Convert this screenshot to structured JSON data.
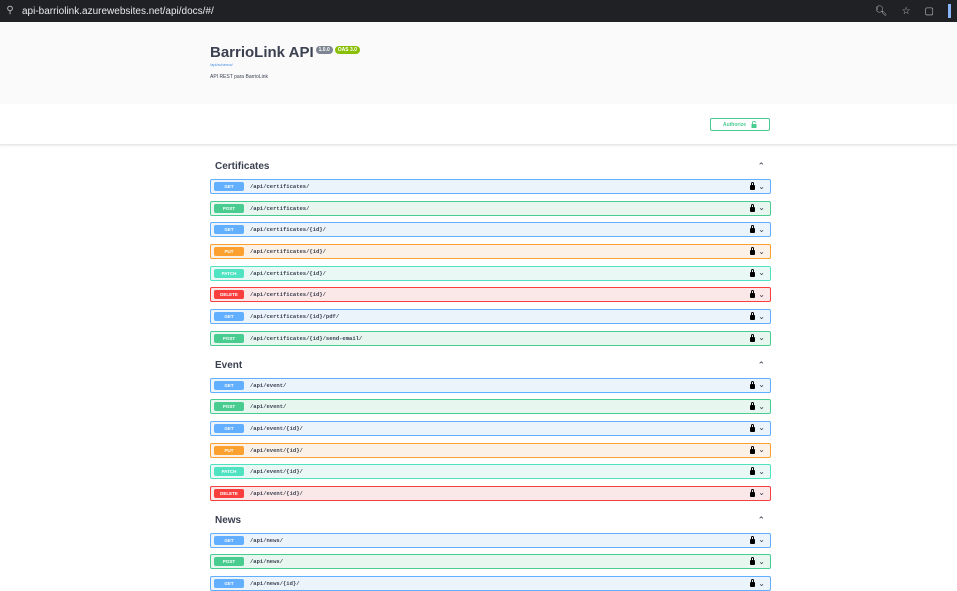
{
  "browser": {
    "url": "api-barriolink.azurewebsites.net/api/docs/#/"
  },
  "info": {
    "title": "BarrioLink API",
    "version": "1.0.0",
    "oas": "OAS 3.0",
    "schema_link": "/api/schema/",
    "description": "API REST para BarrioLink"
  },
  "auth": {
    "label": "Authorize"
  },
  "tags": [
    {
      "name": "Certificates",
      "operations": [
        {
          "method": "GET",
          "path": "/api/certificates/"
        },
        {
          "method": "POST",
          "path": "/api/certificates/"
        },
        {
          "method": "GET",
          "path": "/api/certificates/{id}/"
        },
        {
          "method": "PUT",
          "path": "/api/certificates/{id}/"
        },
        {
          "method": "PATCH",
          "path": "/api/certificates/{id}/"
        },
        {
          "method": "DELETE",
          "path": "/api/certificates/{id}/"
        },
        {
          "method": "GET",
          "path": "/api/certificates/{id}/pdf/"
        },
        {
          "method": "POST",
          "path": "/api/certificates/{id}/send-email/"
        }
      ]
    },
    {
      "name": "Event",
      "operations": [
        {
          "method": "GET",
          "path": "/api/event/"
        },
        {
          "method": "POST",
          "path": "/api/event/"
        },
        {
          "method": "GET",
          "path": "/api/event/{id}/"
        },
        {
          "method": "PUT",
          "path": "/api/event/{id}/"
        },
        {
          "method": "PATCH",
          "path": "/api/event/{id}/"
        },
        {
          "method": "DELETE",
          "path": "/api/event/{id}/"
        }
      ]
    },
    {
      "name": "News",
      "operations": [
        {
          "method": "GET",
          "path": "/api/news/"
        },
        {
          "method": "POST",
          "path": "/api/news/"
        },
        {
          "method": "GET",
          "path": "/api/news/{id}/"
        }
      ]
    }
  ],
  "colors": {
    "get": "#61affe",
    "post": "#49cc90",
    "put": "#fca130",
    "patch": "#50e3c2",
    "delete": "#f93e3e"
  },
  "icons": {
    "lock": "lock-icon",
    "caret": "chevron-down-icon",
    "collapse": "chevron-up-icon"
  }
}
